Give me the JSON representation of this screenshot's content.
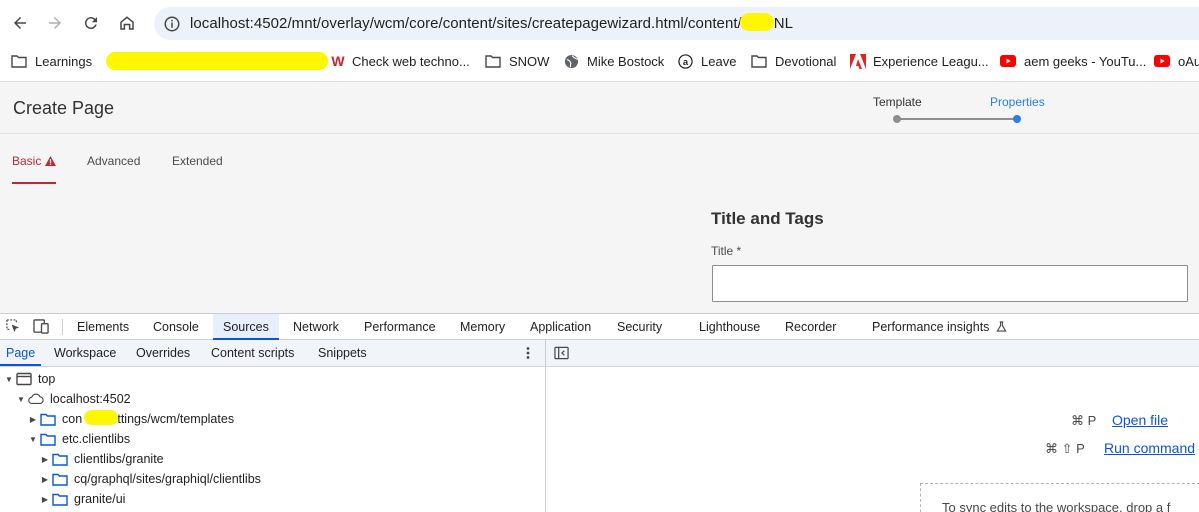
{
  "browser": {
    "url": "localhost:4502/mnt/overlay/wcm/core/content/sites/createpagewizard.html/content/",
    "url_tail": "NL",
    "bookmarks": [
      {
        "label": "Learnings",
        "icon": "folder-icon"
      },
      {
        "label": "Check web techno...",
        "icon": "w-logo-icon"
      },
      {
        "label": "SNOW",
        "icon": "folder-icon"
      },
      {
        "label": "Mike Bostock",
        "icon": "globe-icon"
      },
      {
        "label": "Leave",
        "icon": "a-logo-icon"
      },
      {
        "label": "Devotional",
        "icon": "folder-icon"
      },
      {
        "label": "Experience Leagu...",
        "icon": "adobe-icon"
      },
      {
        "label": "aem geeks - YouTu...",
        "icon": "youtube-icon"
      },
      {
        "label": "oAu",
        "icon": "youtube-icon"
      }
    ]
  },
  "wizard": {
    "title": "Create Page",
    "steps": [
      {
        "label": "Template",
        "state": "done"
      },
      {
        "label": "Properties",
        "state": "active"
      }
    ],
    "tabs": [
      {
        "label": "Basic",
        "active": true,
        "warning": true
      },
      {
        "label": "Advanced",
        "active": false
      },
      {
        "label": "Extended",
        "active": false
      }
    ],
    "section_title": "Title and Tags",
    "title_field": {
      "label": "Title *",
      "value": ""
    }
  },
  "devtools": {
    "tabs": [
      "Elements",
      "Console",
      "Sources",
      "Network",
      "Performance",
      "Memory",
      "Application",
      "Security",
      "Lighthouse",
      "Recorder",
      "Performance insights"
    ],
    "active_tab": "Sources",
    "subtabs": [
      "Page",
      "Workspace",
      "Overrides",
      "Content scripts",
      "Snippets"
    ],
    "active_subtab": "Page",
    "tree": [
      {
        "label": "top",
        "icon": "frame-icon",
        "expanded": true
      },
      {
        "label": "localhost:4502",
        "icon": "cloud-icon",
        "expanded": true
      },
      {
        "label": "con",
        "label_tail": "settings/wcm/templates",
        "icon": "folder-icon",
        "expanded": false
      },
      {
        "label": "etc.clientlibs",
        "icon": "folder-icon",
        "expanded": true
      },
      {
        "label": "clientlibs/granite",
        "icon": "folder-icon",
        "expanded": false
      },
      {
        "label": "cq/graphql/sites/graphiql/clientlibs",
        "icon": "folder-icon",
        "expanded": false
      },
      {
        "label": "granite/ui",
        "icon": "folder-icon",
        "expanded": false
      }
    ],
    "shortcuts": [
      {
        "keys": "⌘ P",
        "action": "Open file"
      },
      {
        "keys": "⌘ ⇧ P",
        "action": "Run command"
      }
    ],
    "drop_text": "To sync edits to the workspace, drop a f"
  },
  "colors": {
    "accent_blue": "#0b57d0",
    "aem_red": "#c9252d",
    "redaction": "#fff700",
    "step_blue": "#2680eb"
  }
}
